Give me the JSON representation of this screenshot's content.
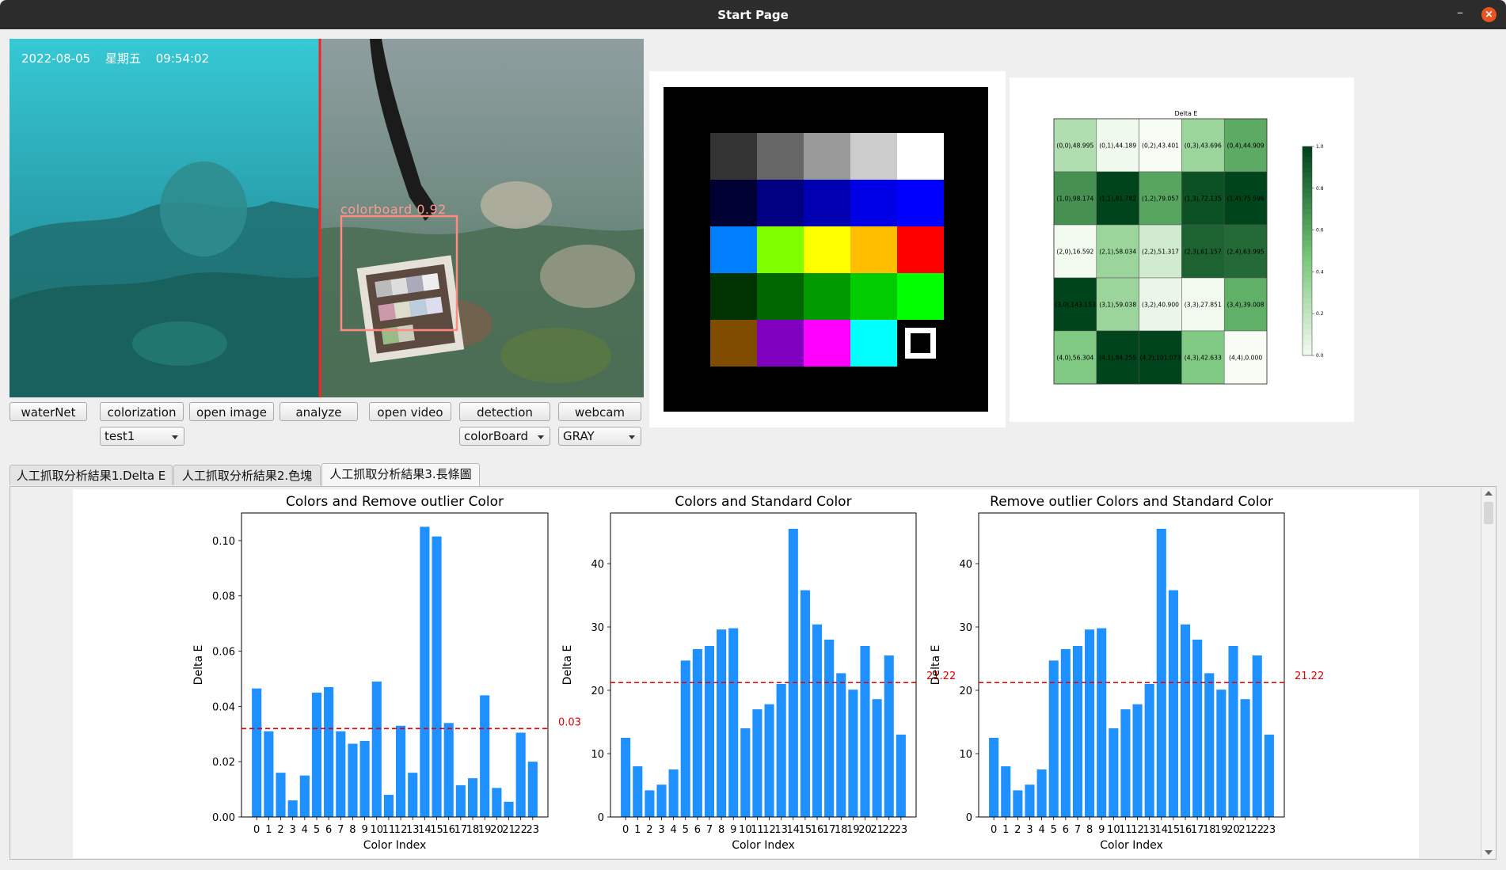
{
  "window": {
    "title": "Start Page",
    "minimize_glyph": "–",
    "close_glyph": "×"
  },
  "video": {
    "timestamp": "2022-08-05",
    "weekday": "星期五",
    "time": "09:54:02",
    "detection_label": "colorboard 0.92"
  },
  "buttons": {
    "waternet": "waterNet",
    "colorization": "colorization",
    "open_image": "open image",
    "analyze": "analyze",
    "open_video": "open video",
    "detection": "detection",
    "webcam": "webcam"
  },
  "selects": {
    "dataset": "test1",
    "mode": "colorBoard",
    "color_space": "GRAY"
  },
  "tabs": [
    {
      "label": "人工抓取分析結果1.Delta E",
      "active": false
    },
    {
      "label": "人工抓取分析結果2.色塊",
      "active": false
    },
    {
      "label": "人工抓取分析結果3.長條圖",
      "active": true
    }
  ],
  "colorboard": {
    "rows": [
      [
        "#333333",
        "#666666",
        "#999999",
        "#cccccc",
        "#ffffff"
      ],
      [
        "#000033",
        "#000080",
        "#0000b3",
        "#0000e6",
        "#0000ff"
      ],
      [
        "#0080ff",
        "#80ff00",
        "#ffff00",
        "#ffbf00",
        "#ff0000"
      ],
      [
        "#003300",
        "#006600",
        "#009900",
        "#00cc00",
        "#00ff00"
      ],
      [
        "#804c00",
        "#8000bf",
        "#ff00ff",
        "#00ffff",
        "marker"
      ]
    ]
  },
  "heatmap": {
    "title": "Delta E",
    "cells": [
      [
        {
          "label": "(0,0),48.995",
          "v": 0.27
        },
        {
          "label": "(0,1),44.189",
          "v": 0.03
        },
        {
          "label": "(0,2),43.401",
          "v": 0.0
        },
        {
          "label": "(0,3),43.696",
          "v": 0.35
        },
        {
          "label": "(0,4),44.909",
          "v": 0.6
        }
      ],
      [
        {
          "label": "(1,0),98.174",
          "v": 0.7
        },
        {
          "label": "(1,1),81.782",
          "v": 1.0
        },
        {
          "label": "(1,2),79.057",
          "v": 0.62
        },
        {
          "label": "(1,3),72.135",
          "v": 0.95
        },
        {
          "label": "(1,4),75.596",
          "v": 1.0
        }
      ],
      [
        {
          "label": "(2,0),16.592",
          "v": 0.02
        },
        {
          "label": "(2,1),58.034",
          "v": 0.35
        },
        {
          "label": "(2,2),51.317",
          "v": 0.15
        },
        {
          "label": "(2,3),61.157",
          "v": 0.88
        },
        {
          "label": "(2,4),63.995",
          "v": 0.85
        }
      ],
      [
        {
          "label": "(3,0),143.153",
          "v": 1.0
        },
        {
          "label": "(3,1),59.038",
          "v": 0.35
        },
        {
          "label": "(3,2),40.900",
          "v": 0.05
        },
        {
          "label": "(3,3),27.851",
          "v": 0.02
        },
        {
          "label": "(3,4),39.008",
          "v": 0.58
        }
      ],
      [
        {
          "label": "(4,0),56.304",
          "v": 0.45
        },
        {
          "label": "(4,1),84.255",
          "v": 1.0
        },
        {
          "label": "(4,2),101.073",
          "v": 1.0
        },
        {
          "label": "(4,3),42.633",
          "v": 0.45
        },
        {
          "label": "(4,4),0.000",
          "v": 0.0
        }
      ]
    ],
    "colorbar_ticks": [
      "0.0",
      "0.2",
      "0.4",
      "0.6",
      "0.8",
      "1.0"
    ]
  },
  "chart_data": [
    {
      "type": "bar",
      "title": "Colors and Remove outlier Color",
      "xlabel": "Color Index",
      "ylabel": "Delta E",
      "categories": [
        "0",
        "1",
        "2",
        "3",
        "4",
        "5",
        "6",
        "7",
        "8",
        "9",
        "10",
        "11",
        "12",
        "13",
        "14",
        "15",
        "16",
        "17",
        "18",
        "19",
        "20",
        "21",
        "22",
        "23"
      ],
      "values": [
        0.0465,
        0.031,
        0.016,
        0.006,
        0.015,
        0.045,
        0.047,
        0.031,
        0.0265,
        0.0275,
        0.049,
        0.008,
        0.033,
        0.016,
        0.105,
        0.1015,
        0.034,
        0.0115,
        0.014,
        0.044,
        0.0105,
        0.0055,
        0.0305,
        0.02
      ],
      "ylim": [
        0,
        0.11
      ],
      "yticks": [
        "0.00",
        "0.02",
        "0.04",
        "0.06",
        "0.08",
        "0.10"
      ],
      "threshold": 0.032,
      "threshold_label": "0.03",
      "bar_color": "#1e90ff",
      "threshold_color": "#e00000"
    },
    {
      "type": "bar",
      "title": "Colors and Standard Color",
      "xlabel": "Color Index",
      "ylabel": "Delta E",
      "categories": [
        "0",
        "1",
        "2",
        "3",
        "4",
        "5",
        "6",
        "7",
        "8",
        "9",
        "10",
        "11",
        "12",
        "13",
        "14",
        "15",
        "16",
        "17",
        "18",
        "19",
        "20",
        "21",
        "22",
        "23"
      ],
      "values": [
        12.5,
        8.0,
        4.2,
        5.1,
        7.5,
        24.7,
        26.5,
        27.0,
        29.6,
        29.8,
        14.0,
        17.0,
        17.8,
        21.0,
        45.5,
        35.8,
        30.4,
        28.0,
        22.7,
        20.1,
        27.0,
        18.6,
        25.5,
        13.0
      ],
      "ylim": [
        0,
        48
      ],
      "yticks": [
        "0",
        "10",
        "20",
        "30",
        "40"
      ],
      "threshold": 21.22,
      "threshold_label": "21.22",
      "bar_color": "#1e90ff",
      "threshold_color": "#e00000"
    },
    {
      "type": "bar",
      "title": "Remove outlier Colors and Standard Color",
      "xlabel": "Color Index",
      "ylabel": "Delta E",
      "categories": [
        "0",
        "1",
        "2",
        "3",
        "4",
        "5",
        "6",
        "7",
        "8",
        "9",
        "10",
        "11",
        "12",
        "13",
        "14",
        "15",
        "16",
        "17",
        "18",
        "19",
        "20",
        "21",
        "22",
        "23"
      ],
      "values": [
        12.5,
        8.0,
        4.2,
        5.1,
        7.5,
        24.7,
        26.5,
        27.0,
        29.6,
        29.8,
        14.0,
        17.0,
        17.8,
        21.0,
        45.5,
        35.8,
        30.4,
        28.0,
        22.7,
        20.1,
        27.0,
        18.6,
        25.5,
        13.0
      ],
      "ylim": [
        0,
        48
      ],
      "yticks": [
        "0",
        "10",
        "20",
        "30",
        "40"
      ],
      "threshold": 21.22,
      "threshold_label": "21.22",
      "bar_color": "#1e90ff",
      "threshold_color": "#e00000"
    }
  ]
}
